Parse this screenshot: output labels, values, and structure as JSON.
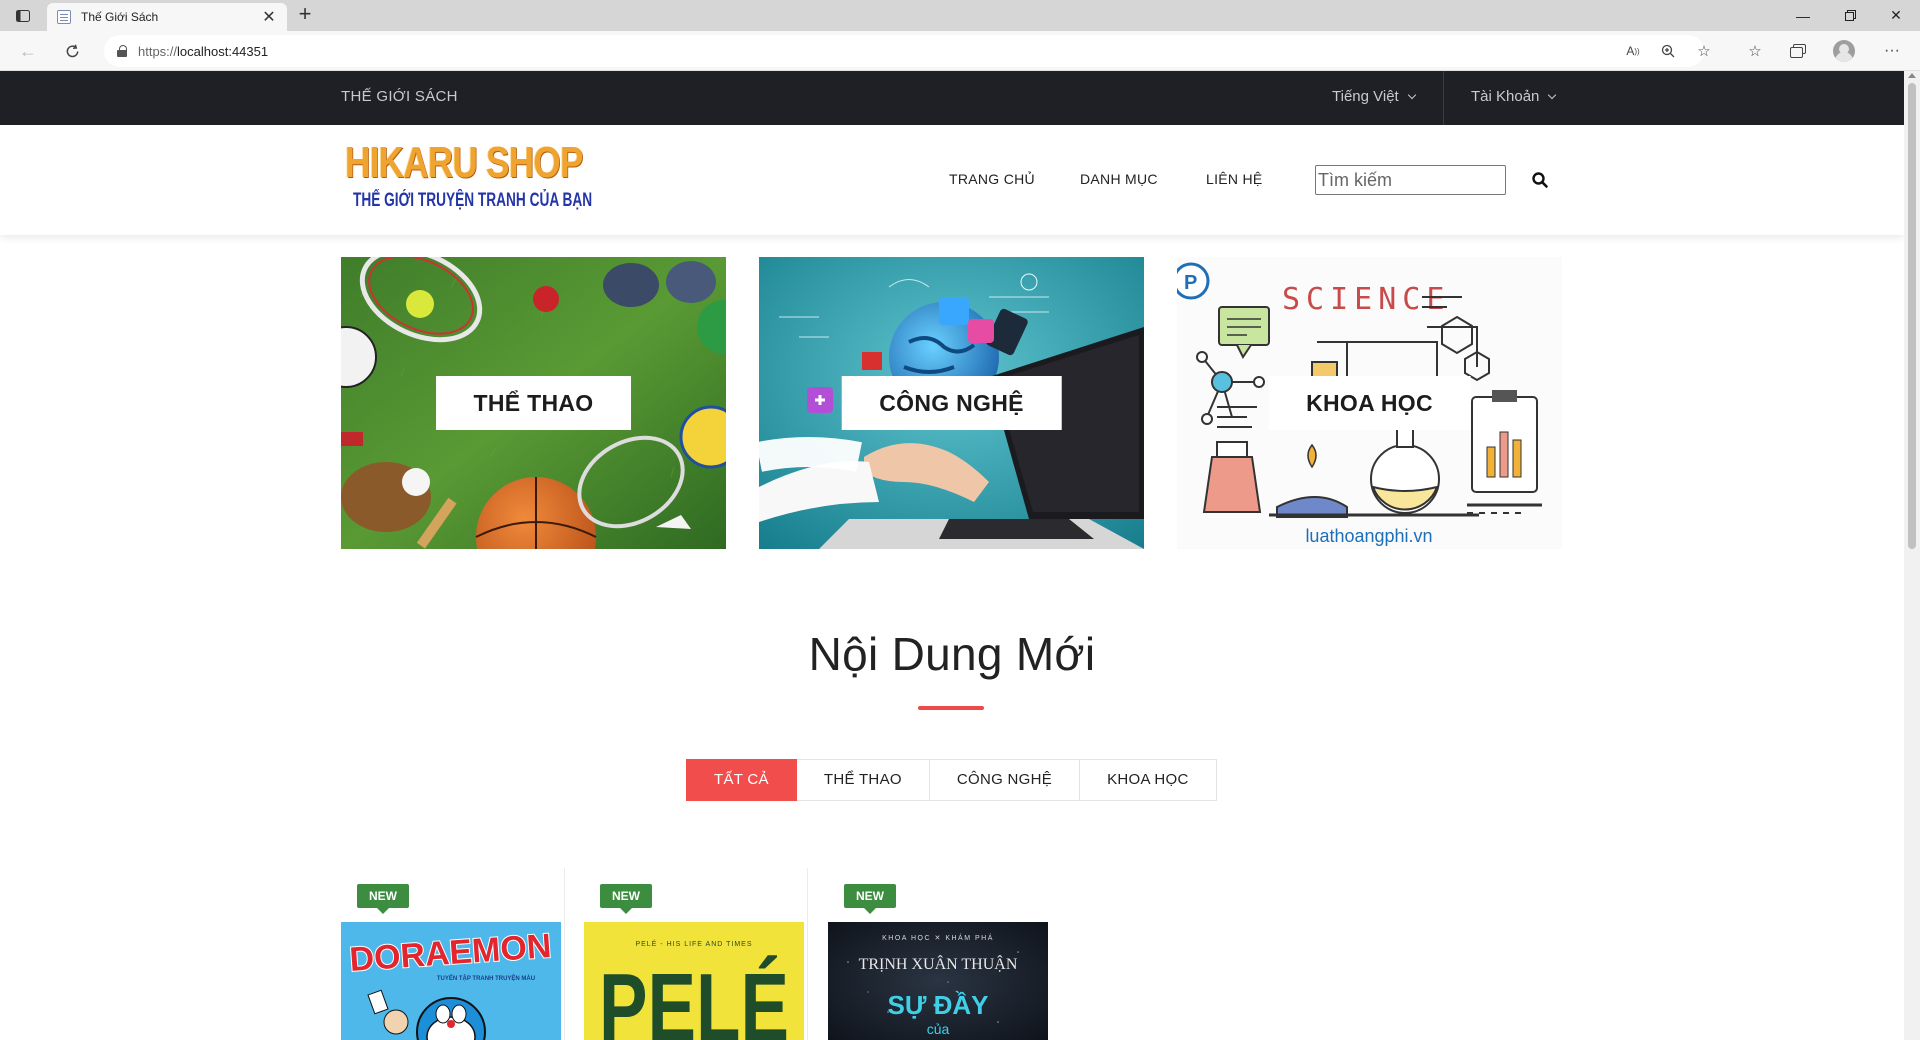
{
  "browser": {
    "tab_title": "Thế Giới Sách",
    "url_scheme": "https://",
    "url_host": "localhost:44351"
  },
  "topbar": {
    "brand": "THẾ GIỚI SÁCH",
    "language": "Tiếng Việt",
    "account": "Tài Khoản"
  },
  "header": {
    "logo_line1": "HIKARU SHOP",
    "logo_line2": "THẾ GIỚI TRUYỆN TRANH CỦA BẠN",
    "nav": [
      "TRANG CHỦ",
      "DANH MỤC",
      "LIÊN HỆ"
    ],
    "search_placeholder": "Tìm kiếm"
  },
  "categories": [
    {
      "label": "THỂ THAO"
    },
    {
      "label": "CÔNG NGHỆ"
    },
    {
      "label": "KHOA HỌC",
      "image_text": "SCIENCE",
      "watermark": "luathoangphi.vn"
    }
  ],
  "section": {
    "title": "Nội Dung Mới",
    "filters": [
      "TẤT CẢ",
      "THỂ THAO",
      "CÔNG NGHỆ",
      "KHOA HỌC"
    ],
    "active_filter": 0
  },
  "products": [
    {
      "badge": "NEW",
      "cover_title": "DORAEMON",
      "cover_sub": "TUYỂN TẬP TRANH TRUYỆN MÀU"
    },
    {
      "badge": "NEW",
      "cover_title": "PELÉ",
      "cover_sub": "PELÉ - HIS LIFE AND TIMES"
    },
    {
      "badge": "NEW",
      "cover_title": "SỰ ĐẦY",
      "cover_sub": "KHOA HỌC ✕ KHÁM PHÁ",
      "cover_author": "TRỊNH XUÂN THUẬN",
      "cover_small": "của"
    }
  ],
  "colors": {
    "accent_red": "#f24d4d",
    "topbar_bg": "#1f1f26",
    "badge_green": "#3c8d3f"
  }
}
